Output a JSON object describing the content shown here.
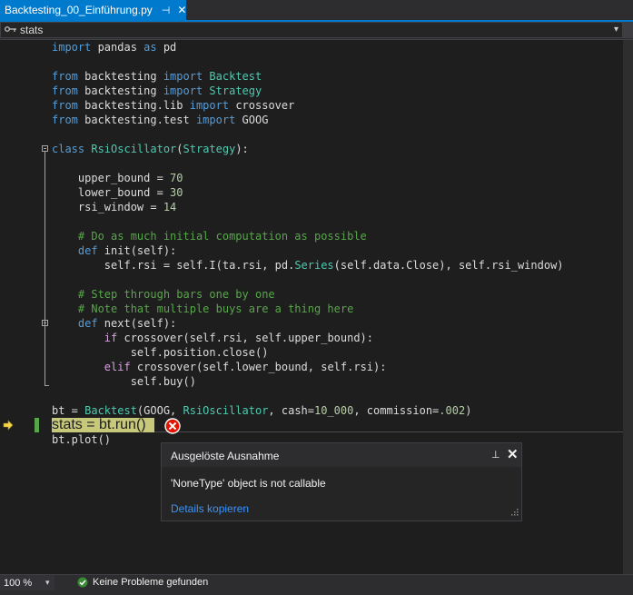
{
  "tab": {
    "title": "Backtesting_00_Einführung.py",
    "pin_icon": "pin-icon",
    "close_icon": "close-icon"
  },
  "navbar": {
    "member": "stats"
  },
  "code_lines": [
    {
      "y": 0,
      "parts": [
        [
          "kw",
          "import"
        ],
        [
          "id",
          " pandas "
        ],
        [
          "kw",
          "as"
        ],
        [
          "id",
          " pd"
        ]
      ]
    },
    {
      "y": 2,
      "parts": [
        [
          "kw",
          "from"
        ],
        [
          "id",
          " backtesting "
        ],
        [
          "kw",
          "import"
        ],
        [
          "id",
          " "
        ],
        [
          "cls",
          "Backtest"
        ]
      ]
    },
    {
      "y": 3,
      "parts": [
        [
          "kw",
          "from"
        ],
        [
          "id",
          " backtesting "
        ],
        [
          "kw",
          "import"
        ],
        [
          "id",
          " "
        ],
        [
          "cls",
          "Strategy"
        ]
      ]
    },
    {
      "y": 4,
      "parts": [
        [
          "kw",
          "from"
        ],
        [
          "id",
          " backtesting.lib "
        ],
        [
          "kw",
          "import"
        ],
        [
          "id",
          " crossover"
        ]
      ]
    },
    {
      "y": 5,
      "parts": [
        [
          "kw",
          "from"
        ],
        [
          "id",
          " backtesting.test "
        ],
        [
          "kw",
          "import"
        ],
        [
          "id",
          " GOOG"
        ]
      ]
    },
    {
      "y": 7,
      "parts": [
        [
          "kw",
          "class"
        ],
        [
          "id",
          " "
        ],
        [
          "cls",
          "RsiOscillator"
        ],
        [
          "id",
          "("
        ],
        [
          "cls",
          "Strategy"
        ],
        [
          "id",
          "):"
        ]
      ]
    },
    {
      "y": 9,
      "parts": [
        [
          "id",
          "    upper_bound = "
        ],
        [
          "num",
          "70"
        ]
      ]
    },
    {
      "y": 10,
      "parts": [
        [
          "id",
          "    lower_bound = "
        ],
        [
          "num",
          "30"
        ]
      ]
    },
    {
      "y": 11,
      "parts": [
        [
          "id",
          "    rsi_window = "
        ],
        [
          "num",
          "14"
        ]
      ]
    },
    {
      "y": 13,
      "parts": [
        [
          "cmt",
          "    # Do as much initial computation as possible"
        ]
      ]
    },
    {
      "y": 14,
      "parts": [
        [
          "kw",
          "    def"
        ],
        [
          "id",
          " init(self):"
        ]
      ]
    },
    {
      "y": 15,
      "parts": [
        [
          "id",
          "        self.rsi = self.I(ta.rsi, pd."
        ],
        [
          "cls",
          "Series"
        ],
        [
          "id",
          "(self.data.Close), self.rsi_window)"
        ]
      ]
    },
    {
      "y": 17,
      "parts": [
        [
          "cmt",
          "    # Step through bars one by one"
        ]
      ]
    },
    {
      "y": 18,
      "parts": [
        [
          "cmt",
          "    # Note that multiple buys are a thing here"
        ]
      ]
    },
    {
      "y": 19,
      "parts": [
        [
          "kw",
          "    def"
        ],
        [
          "id",
          " next(self):"
        ]
      ]
    },
    {
      "y": 20,
      "parts": [
        [
          "kw2",
          "        if"
        ],
        [
          "id",
          " crossover(self.rsi, self.upper_bound):"
        ]
      ]
    },
    {
      "y": 21,
      "parts": [
        [
          "id",
          "            self.position.close()"
        ]
      ]
    },
    {
      "y": 22,
      "parts": [
        [
          "kw2",
          "        elif"
        ],
        [
          "id",
          " crossover(self.lower_bound, self.rsi):"
        ]
      ]
    },
    {
      "y": 23,
      "parts": [
        [
          "id",
          "            self.buy()"
        ]
      ]
    },
    {
      "y": 25,
      "parts": [
        [
          "id",
          "bt = "
        ],
        [
          "cls",
          "Backtest"
        ],
        [
          "id",
          "(GOOG, "
        ],
        [
          "cls",
          "RsiOscillator"
        ],
        [
          "id",
          ", cash="
        ],
        [
          "num",
          "10_000"
        ],
        [
          "id",
          ", commission="
        ],
        [
          "num",
          ".002"
        ],
        [
          "id",
          ")"
        ]
      ]
    },
    {
      "y": 26,
      "parts": [
        [
          "hlt",
          "stats = bt.run()"
        ]
      ]
    },
    {
      "y": 27,
      "parts": [
        [
          "id",
          "bt.plot()"
        ]
      ]
    }
  ],
  "exception_popup": {
    "title": "Ausgelöste Ausnahme",
    "message": "'NoneType' object is not callable",
    "link": "Details kopieren"
  },
  "status": {
    "zoom": "100 %",
    "problems": "Keine Probleme gefunden"
  },
  "colors": {
    "accent": "#007acc",
    "error": "#e51400",
    "ok": "#388a34"
  }
}
